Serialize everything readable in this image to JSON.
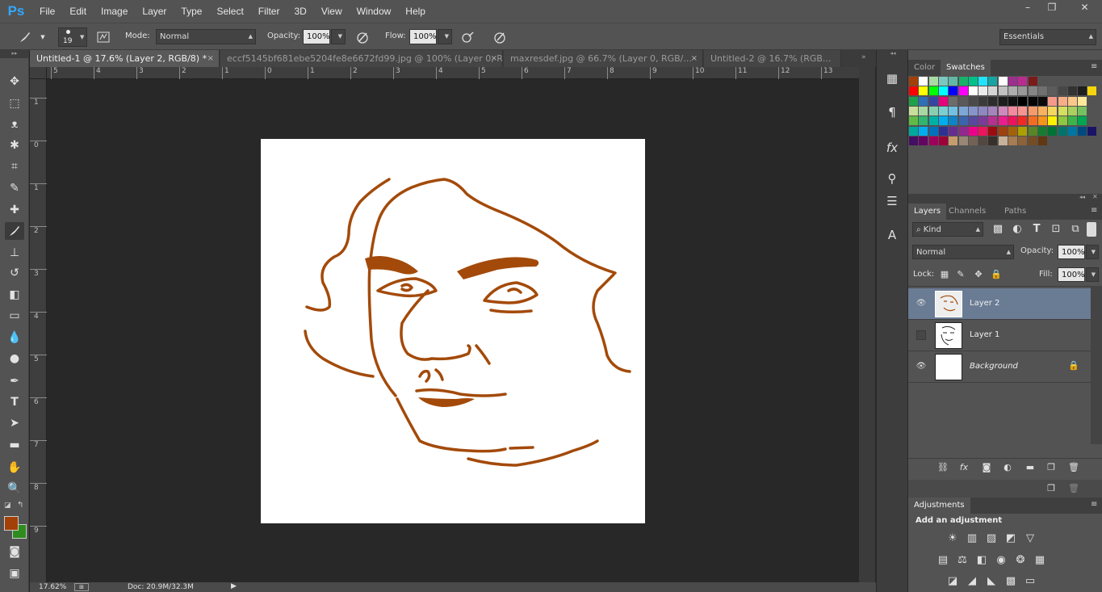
{
  "app": {
    "logo": "Ps",
    "menu": [
      "File",
      "Edit",
      "Image",
      "Layer",
      "Type",
      "Select",
      "Filter",
      "3D",
      "View",
      "Window",
      "Help"
    ],
    "window_buttons": [
      "–",
      "❐",
      "✕"
    ]
  },
  "options": {
    "brush_size": "19",
    "mode_label": "Mode:",
    "mode_value": "Normal",
    "opacity_label": "Opacity:",
    "opacity_value": "100%",
    "flow_label": "Flow:",
    "flow_value": "100%",
    "workspace": "Essentials"
  },
  "tabs": [
    {
      "label": "Untitled-1 @ 17.6% (Layer 2, RGB/8) *",
      "close": "×"
    },
    {
      "label": "eccf5145bf681ebe5204fe8e6672fd99.jpg @ 100% (Layer 0, R...",
      "close": "×"
    },
    {
      "label": "maxresdef.jpg @ 66.7% (Layer 0, RGB/...",
      "close": "×"
    },
    {
      "label": "Untitled-2 @ 16.7% (RGB...",
      "close": "×"
    }
  ],
  "ruler": {
    "h": [
      "5",
      "4",
      "3",
      "2",
      "1",
      "0",
      "1",
      "2",
      "3",
      "4",
      "5",
      "6",
      "7",
      "8",
      "9",
      "10",
      "11",
      "12",
      "13"
    ],
    "v": [
      "1",
      "0",
      "1",
      "2",
      "3",
      "4",
      "5",
      "6",
      "7",
      "8",
      "9"
    ]
  },
  "status": {
    "zoom": "17.62%",
    "doc": "Doc: 20.9M/32.3M"
  },
  "colors": {
    "foreground": "#a34007",
    "background": "#2e8b1e",
    "stroke": "#a34a0a"
  },
  "swatches_panel": {
    "tabs": [
      "Color",
      "Swatches"
    ]
  },
  "layers_panel": {
    "tabs": [
      "Layers",
      "Channels",
      "Paths"
    ],
    "filter_kind": "Kind",
    "blend_mode": "Normal",
    "opacity_label": "Opacity:",
    "opacity_value": "100%",
    "lock_label": "Lock:",
    "fill_label": "Fill:",
    "fill_value": "100%",
    "layers": [
      {
        "name": "Layer 2",
        "visible": true,
        "selected": true
      },
      {
        "name": "Layer 1",
        "visible": false,
        "selected": false
      },
      {
        "name": "Background",
        "visible": true,
        "selected": false,
        "locked": true
      }
    ]
  },
  "adjustments_panel": {
    "tab": "Adjustments",
    "heading": "Add an adjustment"
  }
}
